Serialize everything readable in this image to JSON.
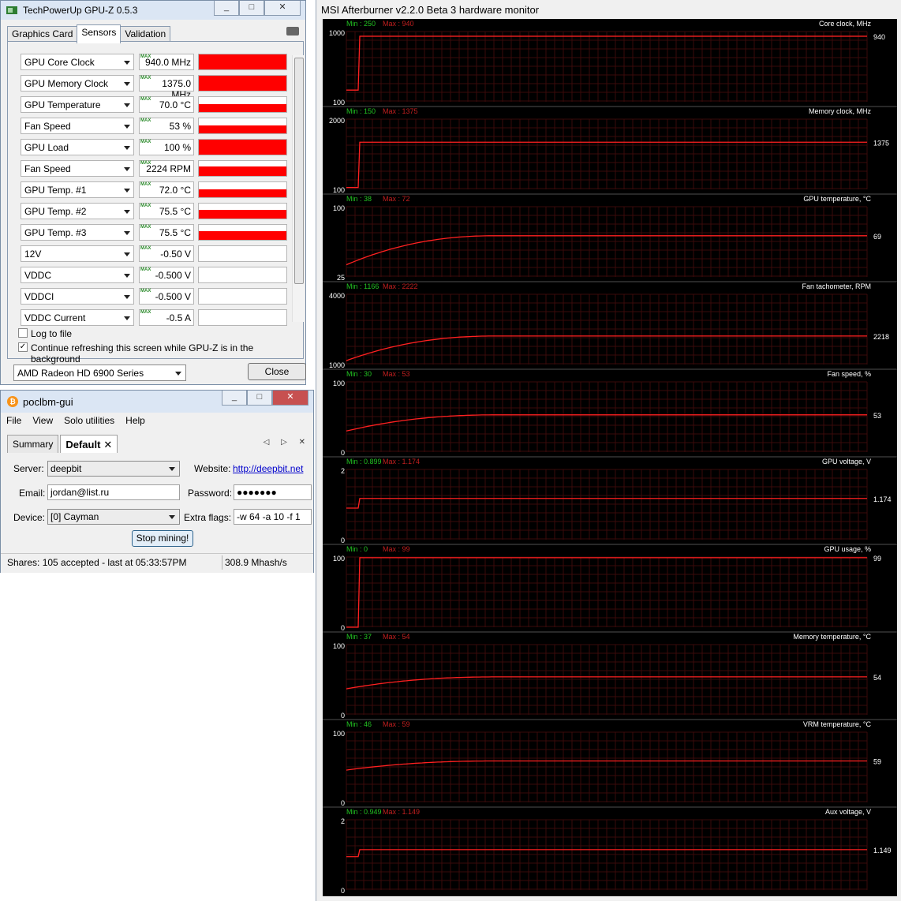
{
  "gpuz": {
    "title": "TechPowerUp GPU-Z 0.5.3",
    "caption_buttons": [
      "_",
      "□",
      "✕"
    ],
    "tabs": [
      {
        "label": "Graphics Card"
      },
      {
        "label": "Sensors",
        "active": true
      },
      {
        "label": "Validation"
      }
    ],
    "max_badge": "MAX",
    "sensors": [
      {
        "name": "GPU Core Clock",
        "value": "940.0 MHz",
        "fill": 1.0
      },
      {
        "name": "GPU Memory Clock",
        "value": "1375.0 MHz",
        "fill": 1.0
      },
      {
        "name": "GPU Temperature",
        "value": "70.0 °C",
        "fill": 0.55
      },
      {
        "name": "Fan Speed",
        "value": "53 %",
        "fill": 0.55
      },
      {
        "name": "GPU Load",
        "value": "100 %",
        "fill": 1.0
      },
      {
        "name": "Fan Speed",
        "value": "2224 RPM",
        "fill": 0.65
      },
      {
        "name": "GPU Temp. #1",
        "value": "72.0 °C",
        "fill": 0.55
      },
      {
        "name": "GPU Temp. #2",
        "value": "75.5 °C",
        "fill": 0.6
      },
      {
        "name": "GPU Temp. #3",
        "value": "75.5 °C",
        "fill": 0.6
      },
      {
        "name": "12V",
        "value": "-0.50 V",
        "fill": 0
      },
      {
        "name": "VDDC",
        "value": "-0.500 V",
        "fill": 0
      },
      {
        "name": "VDDCI",
        "value": "-0.500 V",
        "fill": 0
      },
      {
        "name": "VDDC Current",
        "value": "-0.5 A",
        "fill": 0
      }
    ],
    "log_to_file_label": "Log to file",
    "log_to_file_checked": false,
    "continue_refresh_label": "Continue refreshing this screen while GPU-Z is in the background",
    "continue_refresh_checked": true,
    "card_select": "AMD Radeon HD 6900 Series",
    "close_label": "Close"
  },
  "poclbm": {
    "title": "poclbm-gui",
    "menu": [
      "File",
      "View",
      "Solo utilities",
      "Help"
    ],
    "tabs": [
      {
        "label": "Summary"
      },
      {
        "label": "Default",
        "active": true,
        "close": "✕"
      }
    ],
    "tab_nav": "◁ ▷ ✕",
    "server_label": "Server:",
    "server_value": "deepbit",
    "website_label": "Website:",
    "website_link": "http://deepbit.net",
    "email_label": "Email:",
    "email_value": "jordan@list.ru",
    "password_label": "Password:",
    "password_value": "●●●●●●●",
    "device_label": "Device:",
    "device_value": "[0] Cayman",
    "flags_label": "Extra flags:",
    "flags_value": "-w 64 -a 10 -f 1",
    "stop_label": "Stop mining!",
    "status_shares": "Shares: 105 accepted - last at 05:33:57PM",
    "status_rate": "308.9 Mhash/s"
  },
  "afterburner": {
    "title": "MSI Afterburner v2.2.0 Beta 3 hardware monitor",
    "colors": {
      "background": "#000000",
      "grid": "#3a0a0a",
      "line": "#ff2020",
      "min": "#22c322",
      "max": "#c31f1f",
      "text": "#ffffff"
    },
    "graphs": [
      {
        "label": "Core clock, MHz",
        "min_text": "Min : 250",
        "max_text": "Max : 940",
        "top": "1000",
        "bottom": "100",
        "current": "940",
        "ylim": [
          100,
          1000
        ],
        "shape": "step",
        "start": 250,
        "value": 940
      },
      {
        "label": "Memory clock, MHz",
        "min_text": "Min : 150",
        "max_text": "Max : 1375",
        "top": "2000",
        "bottom": "100",
        "current": "1375",
        "ylim": [
          100,
          2000
        ],
        "shape": "step",
        "start": 150,
        "value": 1375
      },
      {
        "label": "GPU temperature, °C",
        "min_text": "Min : 38",
        "max_text": "Max : 72",
        "top": "100",
        "bottom": "25",
        "current": "69",
        "ylim": [
          25,
          100
        ],
        "shape": "curve",
        "start": 38,
        "value": 69
      },
      {
        "label": "Fan tachometer, RPM",
        "min_text": "Min : 1166",
        "max_text": "Max : 2222",
        "top": "4000",
        "bottom": "1000",
        "current": "2218",
        "ylim": [
          1000,
          4000
        ],
        "shape": "curve",
        "start": 1166,
        "value": 2218
      },
      {
        "label": "Fan speed, %",
        "min_text": "Min : 30",
        "max_text": "Max : 53",
        "top": "100",
        "bottom": "0",
        "current": "53",
        "ylim": [
          0,
          100
        ],
        "shape": "curve",
        "start": 30,
        "value": 53
      },
      {
        "label": "GPU voltage, V",
        "min_text": "Min : 0.899",
        "max_text": "Max : 1.174",
        "top": "2",
        "bottom": "0",
        "current": "1.174",
        "ylim": [
          0,
          2
        ],
        "shape": "step",
        "start": 0.899,
        "value": 1.174
      },
      {
        "label": "GPU usage, %",
        "min_text": "Min : 0",
        "max_text": "Max : 99",
        "top": "100",
        "bottom": "0",
        "current": "99",
        "ylim": [
          0,
          100
        ],
        "shape": "step",
        "start": 0,
        "value": 99
      },
      {
        "label": "Memory temperature, °C",
        "min_text": "Min : 37",
        "max_text": "Max : 54",
        "top": "100",
        "bottom": "0",
        "current": "54",
        "ylim": [
          0,
          100
        ],
        "shape": "curve",
        "start": 37,
        "value": 54
      },
      {
        "label": "VRM temperature, °C",
        "min_text": "Min : 46",
        "max_text": "Max : 59",
        "top": "100",
        "bottom": "0",
        "current": "59",
        "ylim": [
          0,
          100
        ],
        "shape": "curve",
        "start": 46,
        "value": 59
      },
      {
        "label": "Aux voltage, V",
        "min_text": "Min : 0.949",
        "max_text": "Max : 1.149",
        "top": "2",
        "bottom": "0",
        "current": "1.149",
        "ylim": [
          0,
          2
        ],
        "shape": "step",
        "start": 0.949,
        "value": 1.149
      }
    ]
  }
}
